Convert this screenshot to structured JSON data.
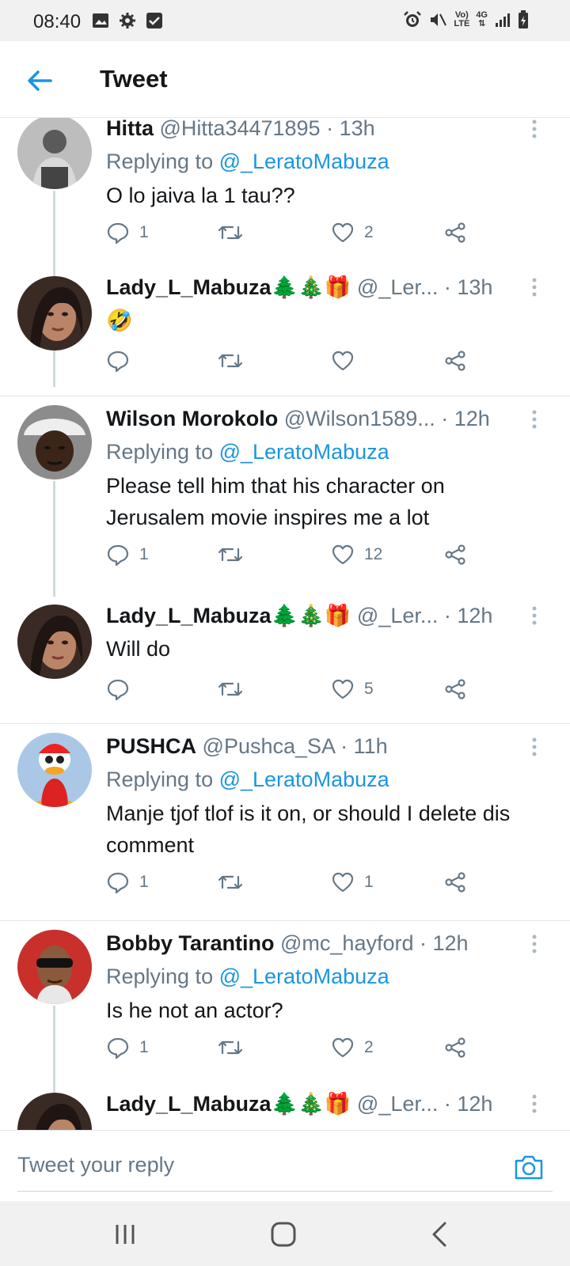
{
  "status_bar": {
    "time": "08:40",
    "left_icons": [
      "image-icon",
      "gear-icon",
      "checkbox-icon"
    ],
    "net_label_top": "Vo)",
    "net_label_bottom": "LTE",
    "gen_label": "4G"
  },
  "header": {
    "title": "Tweet"
  },
  "tweets": [
    {
      "name": "Hitta",
      "handle": "@Hitta34471895",
      "time": "· 13h",
      "reply_prefix": "Replying to ",
      "reply_to": "@_LeratoMabuza",
      "text": "O lo jaiva la 1 tau??",
      "reply_count": "1",
      "retweet_count": "",
      "like_count": "2"
    },
    {
      "name": "Lady_L_Mabuza🌲🎄🎁",
      "handle": "@_Ler...",
      "time": "· 13h",
      "text": "🤣",
      "reply_count": "",
      "retweet_count": "",
      "like_count": ""
    },
    {
      "name": "Wilson Morokolo",
      "handle": "@Wilson1589...",
      "time": "· 12h",
      "reply_prefix": "Replying to ",
      "reply_to": "@_LeratoMabuza",
      "text": "Please tell him that his character on Jerusalem movie inspires me a lot",
      "reply_count": "1",
      "retweet_count": "",
      "like_count": "12"
    },
    {
      "name": "Lady_L_Mabuza🌲🎄🎁",
      "handle": "@_Ler...",
      "time": "· 12h",
      "text": "Will do",
      "reply_count": "",
      "retweet_count": "",
      "like_count": "5"
    },
    {
      "name": "PUSHCA",
      "handle": "@Pushca_SA",
      "time": "· 11h",
      "reply_prefix": "Replying to ",
      "reply_to": "@_LeratoMabuza",
      "text": "Manje tjof tlof is it on, or should I delete dis comment",
      "reply_count": "1",
      "retweet_count": "",
      "like_count": "1"
    },
    {
      "name": "Bobby Tarantino",
      "handle": "@mc_hayford",
      "time": "· 12h",
      "reply_prefix": "Replying to ",
      "reply_to": "@_LeratoMabuza",
      "text": "Is he not an actor?",
      "reply_count": "1",
      "retweet_count": "",
      "like_count": "2"
    },
    {
      "name": "Lady_L_Mabuza🌲🎄🎁",
      "handle": "@_Ler...",
      "time": "· 12h"
    }
  ],
  "reply_bar": {
    "placeholder": "Tweet your reply"
  },
  "colors": {
    "accent": "#1b95e0",
    "secondary_text": "#657786",
    "primary_text": "#14171a",
    "divider": "#e1e8ed"
  }
}
